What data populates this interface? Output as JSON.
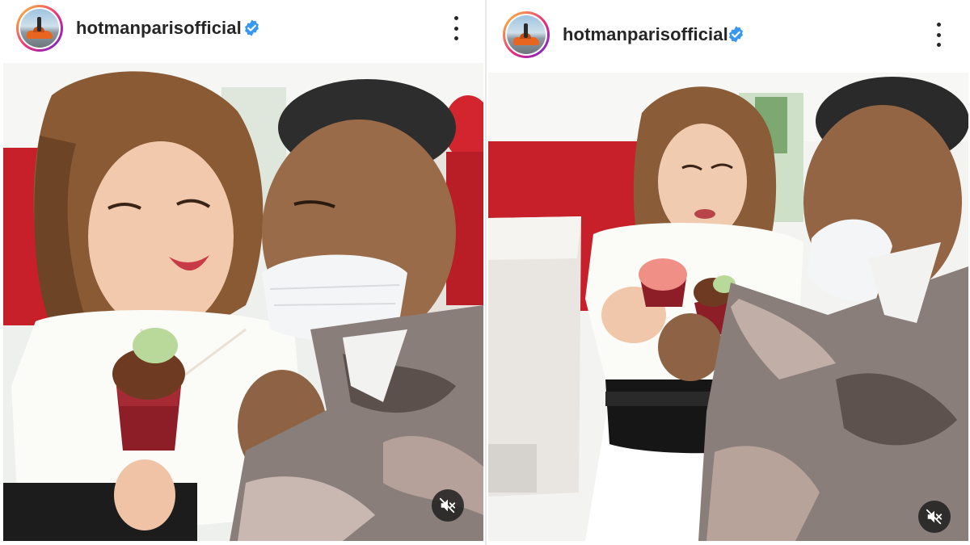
{
  "posts": [
    {
      "account": {
        "username": "hotmanparisofficial",
        "verified": true,
        "avatar_icon": "profile-avatar",
        "verified_icon": "verified-badge-icon"
      },
      "menu_icon": "more-options-icon",
      "media": {
        "type": "video",
        "muted": true,
        "mute_icon": "speaker-muted-icon"
      }
    },
    {
      "account": {
        "username": "hotmanparisofficial",
        "verified": true,
        "avatar_icon": "profile-avatar",
        "verified_icon": "verified-badge-icon"
      },
      "menu_icon": "more-options-icon",
      "media": {
        "type": "video",
        "muted": true,
        "mute_icon": "speaker-muted-icon"
      }
    }
  ],
  "colors": {
    "text": "#262626",
    "verified_blue": "#3897f0",
    "avatar_ring": "#ee2a7b",
    "mute_bg": "#1e1e1e",
    "wall_red": "#c8202a"
  }
}
